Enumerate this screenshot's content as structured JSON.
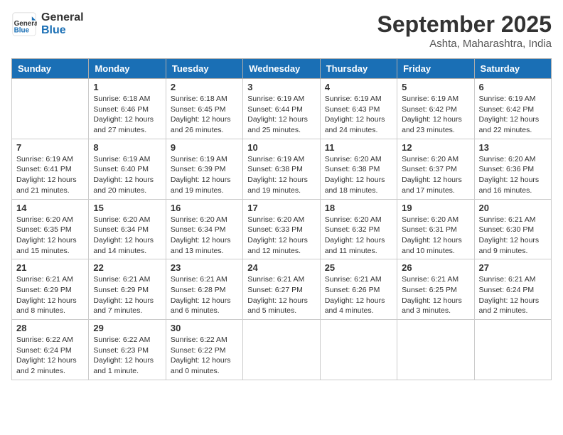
{
  "logo": {
    "text_general": "General",
    "text_blue": "Blue"
  },
  "title": "September 2025",
  "subtitle": "Ashta, Maharashtra, India",
  "weekdays": [
    "Sunday",
    "Monday",
    "Tuesday",
    "Wednesday",
    "Thursday",
    "Friday",
    "Saturday"
  ],
  "weeks": [
    [
      {
        "day": null
      },
      {
        "day": "1",
        "sunrise": "6:18 AM",
        "sunset": "6:46 PM",
        "daylight": "12 hours and 27 minutes."
      },
      {
        "day": "2",
        "sunrise": "6:18 AM",
        "sunset": "6:45 PM",
        "daylight": "12 hours and 26 minutes."
      },
      {
        "day": "3",
        "sunrise": "6:19 AM",
        "sunset": "6:44 PM",
        "daylight": "12 hours and 25 minutes."
      },
      {
        "day": "4",
        "sunrise": "6:19 AM",
        "sunset": "6:43 PM",
        "daylight": "12 hours and 24 minutes."
      },
      {
        "day": "5",
        "sunrise": "6:19 AM",
        "sunset": "6:42 PM",
        "daylight": "12 hours and 23 minutes."
      },
      {
        "day": "6",
        "sunrise": "6:19 AM",
        "sunset": "6:42 PM",
        "daylight": "12 hours and 22 minutes."
      }
    ],
    [
      {
        "day": "7",
        "sunrise": "6:19 AM",
        "sunset": "6:41 PM",
        "daylight": "12 hours and 21 minutes."
      },
      {
        "day": "8",
        "sunrise": "6:19 AM",
        "sunset": "6:40 PM",
        "daylight": "12 hours and 20 minutes."
      },
      {
        "day": "9",
        "sunrise": "6:19 AM",
        "sunset": "6:39 PM",
        "daylight": "12 hours and 19 minutes."
      },
      {
        "day": "10",
        "sunrise": "6:19 AM",
        "sunset": "6:38 PM",
        "daylight": "12 hours and 19 minutes."
      },
      {
        "day": "11",
        "sunrise": "6:20 AM",
        "sunset": "6:38 PM",
        "daylight": "12 hours and 18 minutes."
      },
      {
        "day": "12",
        "sunrise": "6:20 AM",
        "sunset": "6:37 PM",
        "daylight": "12 hours and 17 minutes."
      },
      {
        "day": "13",
        "sunrise": "6:20 AM",
        "sunset": "6:36 PM",
        "daylight": "12 hours and 16 minutes."
      }
    ],
    [
      {
        "day": "14",
        "sunrise": "6:20 AM",
        "sunset": "6:35 PM",
        "daylight": "12 hours and 15 minutes."
      },
      {
        "day": "15",
        "sunrise": "6:20 AM",
        "sunset": "6:34 PM",
        "daylight": "12 hours and 14 minutes."
      },
      {
        "day": "16",
        "sunrise": "6:20 AM",
        "sunset": "6:34 PM",
        "daylight": "12 hours and 13 minutes."
      },
      {
        "day": "17",
        "sunrise": "6:20 AM",
        "sunset": "6:33 PM",
        "daylight": "12 hours and 12 minutes."
      },
      {
        "day": "18",
        "sunrise": "6:20 AM",
        "sunset": "6:32 PM",
        "daylight": "12 hours and 11 minutes."
      },
      {
        "day": "19",
        "sunrise": "6:20 AM",
        "sunset": "6:31 PM",
        "daylight": "12 hours and 10 minutes."
      },
      {
        "day": "20",
        "sunrise": "6:21 AM",
        "sunset": "6:30 PM",
        "daylight": "12 hours and 9 minutes."
      }
    ],
    [
      {
        "day": "21",
        "sunrise": "6:21 AM",
        "sunset": "6:29 PM",
        "daylight": "12 hours and 8 minutes."
      },
      {
        "day": "22",
        "sunrise": "6:21 AM",
        "sunset": "6:29 PM",
        "daylight": "12 hours and 7 minutes."
      },
      {
        "day": "23",
        "sunrise": "6:21 AM",
        "sunset": "6:28 PM",
        "daylight": "12 hours and 6 minutes."
      },
      {
        "day": "24",
        "sunrise": "6:21 AM",
        "sunset": "6:27 PM",
        "daylight": "12 hours and 5 minutes."
      },
      {
        "day": "25",
        "sunrise": "6:21 AM",
        "sunset": "6:26 PM",
        "daylight": "12 hours and 4 minutes."
      },
      {
        "day": "26",
        "sunrise": "6:21 AM",
        "sunset": "6:25 PM",
        "daylight": "12 hours and 3 minutes."
      },
      {
        "day": "27",
        "sunrise": "6:21 AM",
        "sunset": "6:24 PM",
        "daylight": "12 hours and 2 minutes."
      }
    ],
    [
      {
        "day": "28",
        "sunrise": "6:22 AM",
        "sunset": "6:24 PM",
        "daylight": "12 hours and 2 minutes."
      },
      {
        "day": "29",
        "sunrise": "6:22 AM",
        "sunset": "6:23 PM",
        "daylight": "12 hours and 1 minute."
      },
      {
        "day": "30",
        "sunrise": "6:22 AM",
        "sunset": "6:22 PM",
        "daylight": "12 hours and 0 minutes."
      },
      {
        "day": null
      },
      {
        "day": null
      },
      {
        "day": null
      },
      {
        "day": null
      }
    ]
  ],
  "labels": {
    "sunrise": "Sunrise:",
    "sunset": "Sunset:",
    "daylight": "Daylight:"
  }
}
